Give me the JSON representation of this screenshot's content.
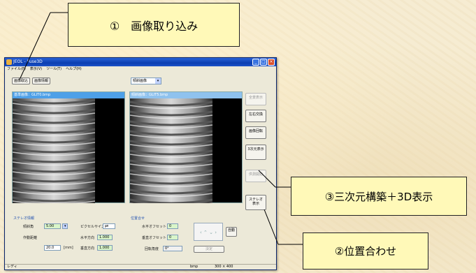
{
  "window": {
    "title": "JEOL - Fuse3D",
    "menu": [
      "ファイル(F)",
      "表示(V)",
      "ツール(T)",
      "ヘルプ(H)"
    ],
    "toolbar": {
      "import_label": "画像取込",
      "info_label": "画像情報"
    },
    "mode_select": {
      "value": "傾斜画像"
    },
    "left_panel": {
      "header": "基準画像：GLIT0.bmp"
    },
    "right_panel": {
      "header": "傾斜画像：GLIT5.bmp"
    },
    "side_buttons": [
      {
        "label": "全景表示",
        "enabled": false
      },
      {
        "label": "左右交換",
        "enabled": true
      },
      {
        "label": "画像回転",
        "enabled": true
      },
      {
        "label": "3次元表示",
        "enabled": true
      },
      {
        "label": "供測開始",
        "enabled": false
      },
      {
        "label": "ステレオ表示",
        "enabled": true
      }
    ],
    "stereo": {
      "section": "ステレオ情報",
      "tilt_label": "傾斜角",
      "tilt_value": "5.00",
      "pixel_label": "ピクセルサイズ",
      "pixel_unit": "㎛",
      "workdist_label": "作動距離",
      "workdist_value": "20.0",
      "workdist_unit": "[mm]",
      "h_label": "水平方向",
      "h_value": "1.000",
      "v_label": "垂直方向",
      "v_value": "1.000"
    },
    "align": {
      "section": "位置合せ",
      "h_offset_label": "水平オフセット",
      "h_offset_value": "0",
      "v_offset_label": "垂直オフセット",
      "v_offset_value": "0",
      "rotation_label": "回転角度",
      "rotation_value": "0°",
      "auto_label": "自動",
      "apply_label": "決定"
    },
    "status": {
      "left": "レディ",
      "format": "bmp",
      "size": "300 × 400"
    }
  },
  "callouts": {
    "import": "①　画像取り込み",
    "align": "②位置合わせ",
    "build3d": "③三次元構築＋3D表示"
  },
  "colors": {
    "callout_bg": "#fff9b8",
    "title_blue": "#0b3fb0",
    "panel_header": "#4ea0e8"
  }
}
